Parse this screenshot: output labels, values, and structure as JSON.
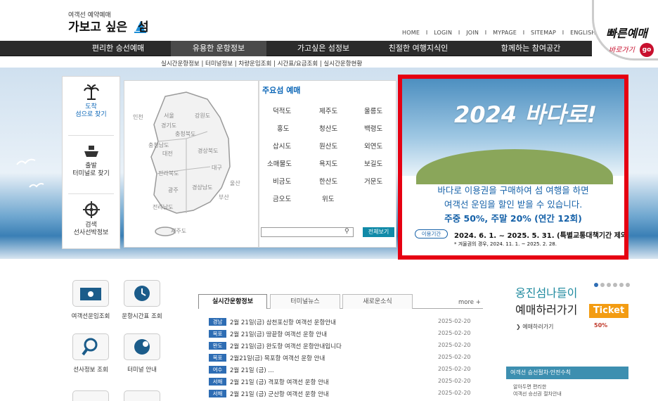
{
  "header": {
    "logo_small": "여객선 예약예매",
    "logo_main": "가보고 싶은",
    "logo_tail": "섬",
    "util_links": [
      "HOME",
      "LOGIN",
      "JOIN",
      "MYPAGE",
      "SITEMAP",
      "ENGLISH"
    ],
    "quick_title": "빠른예매",
    "quick_sub": "바로가기",
    "quick_go": "go"
  },
  "nav": {
    "items": [
      "편리한 승선예매",
      "유용한 운항정보",
      "가고싶은 섬정보",
      "친절한 여행지식인",
      "함께하는 참여공간"
    ],
    "active": "유용한 운항정보",
    "sub": "실시간운항정보 | 터미널정보 | 차량운임조회 | 시간표/요금조회 | 실시간운항현황"
  },
  "leftcol": {
    "items": [
      {
        "line1": "도착",
        "line2": "섬으로 찾기",
        "icon": "palm-tree-icon"
      },
      {
        "line1": "출발",
        "line2": "터미널로 찾기",
        "icon": "ship-icon"
      },
      {
        "line1": "검색",
        "line2": "선사선박정보",
        "icon": "ship-wheel-icon"
      }
    ]
  },
  "map": {
    "regions": [
      "인천",
      "서울",
      "경기도",
      "강원도",
      "충청북도",
      "충청남도",
      "대전",
      "경상북도",
      "대구",
      "전라북도",
      "울산",
      "광주",
      "경상남도",
      "부산",
      "전라남도",
      "제주도"
    ]
  },
  "islands": {
    "title": "주요섬 예매",
    "names": [
      "덕적도",
      "제주도",
      "울릉도",
      "홍도",
      "청산도",
      "백령도",
      "삽시도",
      "원산도",
      "외연도",
      "소매물도",
      "욕지도",
      "보길도",
      "비금도",
      "한산도",
      "거문도",
      "금오도",
      "위도"
    ],
    "search_placeholder": "",
    "view_all": "전체보기"
  },
  "promo": {
    "title": "2024 바다로!",
    "line1": "바다로 이용권을 구매하여 섬 여행을 하면",
    "line2": "여객선 운임을 할인 받을 수 있습니다.",
    "line3": "주중 50%, 주말 20% (연간 12회)",
    "period_badge": "이용기간",
    "period": "2024. 6. 1. ~ 2025. 5. 31. (특별교통대책기간 제외)",
    "note": "* 겨울권의 경우, 2024. 11. 1. ~ 2025. 2. 28."
  },
  "quicklinks": [
    "여객선운임조회",
    "운항시간표 조회",
    "선사정보 조회",
    "터미널 안내"
  ],
  "news": {
    "tabs": [
      "실시간운항정보",
      "터미널뉴스",
      "새로운소식"
    ],
    "more": "more +",
    "rows": [
      {
        "region": "경남",
        "title": "2월 21일(금) 삼천포신항 여객선 운항안내",
        "date": "2025-02-20"
      },
      {
        "region": "목포",
        "title": "2월 21일(금) 땅끝항 여객선 운항 안내",
        "date": "2025-02-20"
      },
      {
        "region": "완도",
        "title": "2월 21일(금) 완도항 여객선 운항안내입니다",
        "date": "2025-02-20"
      },
      {
        "region": "목포",
        "title": "2월21일(금) 목포항 여객선 운항 안내",
        "date": "2025-02-20"
      },
      {
        "region": "여수",
        "title": "2월 21일 (금) ...",
        "date": "2025-02-20"
      },
      {
        "region": "서해",
        "title": "2월 21일 (금) 격포항 여객선 운항 안내",
        "date": "2025-02-20"
      },
      {
        "region": "서해",
        "title": "2월 21일 (금) 군산항 여객선 운항 안내",
        "date": "2025-02-20"
      }
    ]
  },
  "side": {
    "line1": "옹진섬나들이",
    "line2": "예매하러가기",
    "link": "예매하러가기",
    "ticket": "Ticket",
    "badge": "50%",
    "banner": "여객선 승선절차·안전수칙",
    "sub1": "알아두면 편리한",
    "sub2": "여객선 승선권 절차안내"
  },
  "colors": {
    "accent": "#0b66b7",
    "promo_border": "#e60012",
    "nav_bg": "#2b2b2b"
  }
}
